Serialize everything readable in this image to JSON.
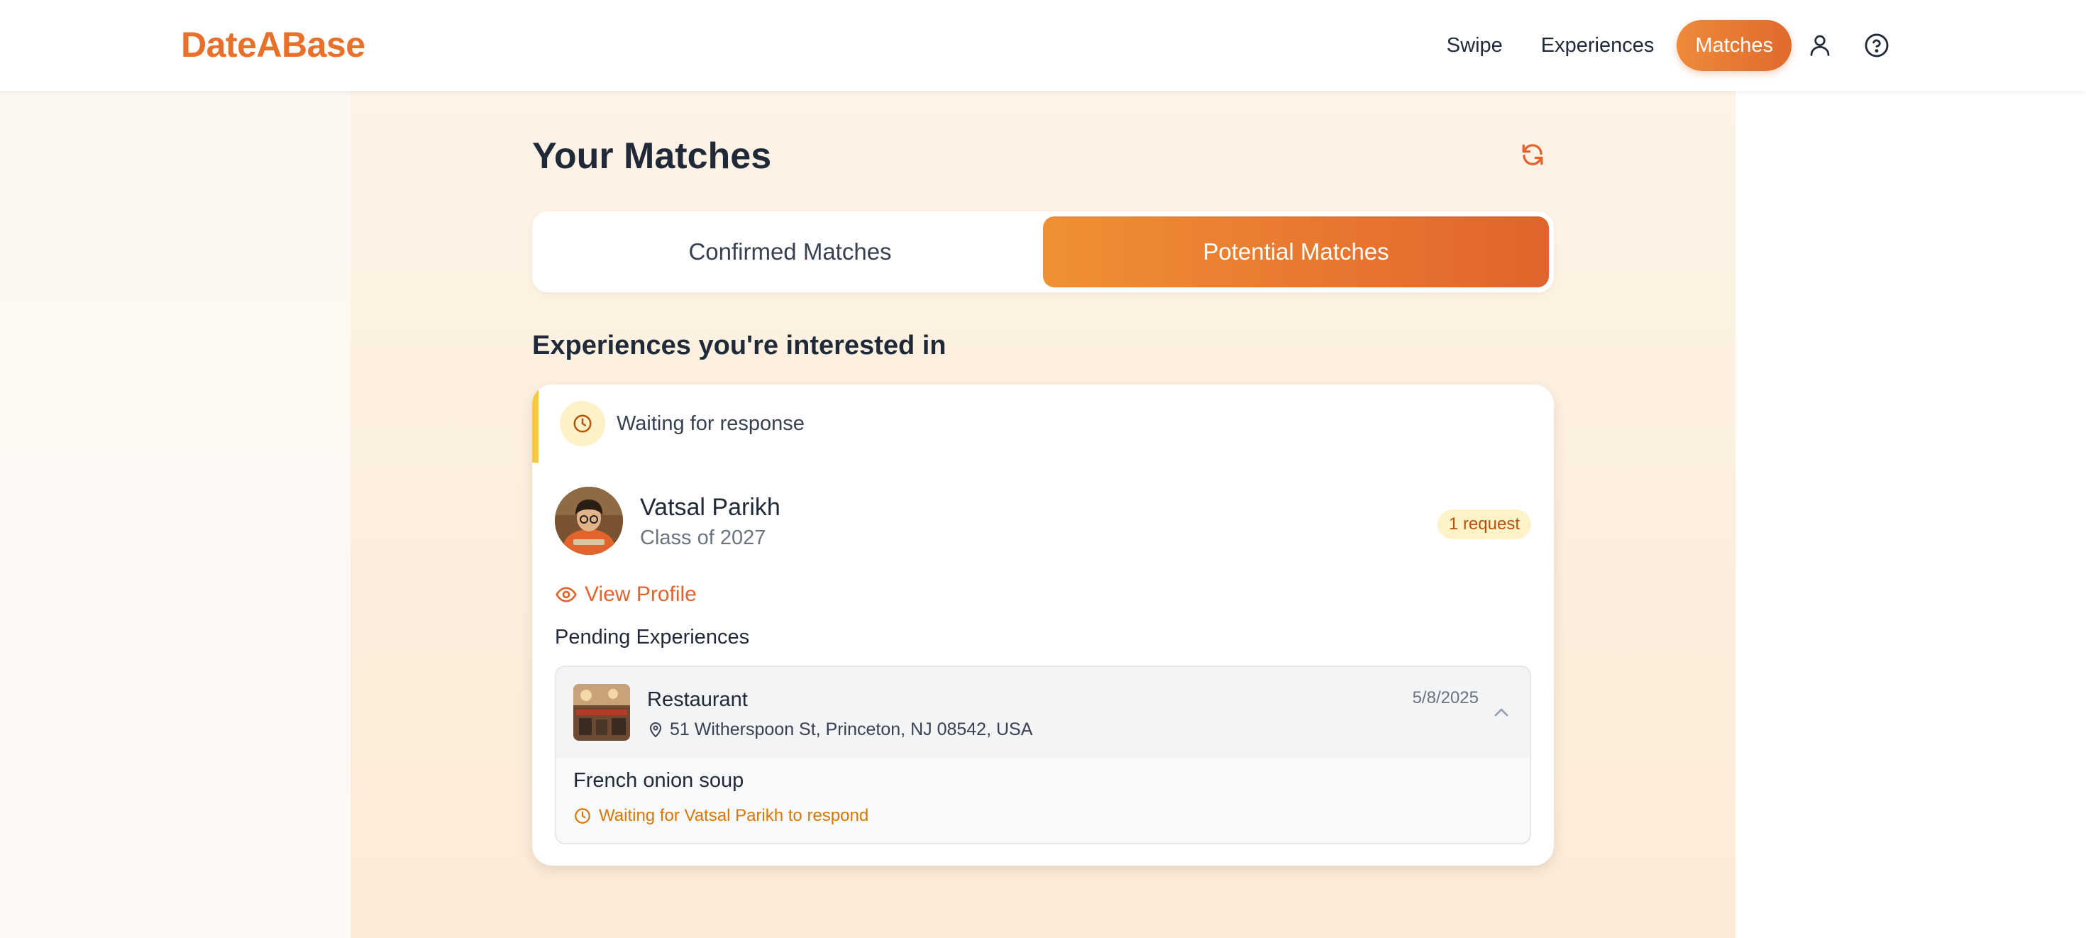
{
  "app": {
    "logo": "DateABase",
    "accent": "#e8702a"
  },
  "nav": {
    "swipe": "Swipe",
    "experiences": "Experiences",
    "matches": "Matches",
    "icons": [
      "profile-icon",
      "help-icon"
    ]
  },
  "page": {
    "title": "Your Matches",
    "refresh_icon": "refresh-icon"
  },
  "tabs": {
    "confirmed": "Confirmed Matches",
    "potential": "Potential Matches",
    "active": "Potential Matches"
  },
  "section": {
    "title": "Experiences you're interested in"
  },
  "card": {
    "status": "Waiting for response",
    "status_color": "#f5c842",
    "person": {
      "name": "Vatsal Parikh",
      "class": "Class of 2027",
      "badge": "1 request"
    },
    "view_profile": "View Profile",
    "pending_label": "Pending Experiences",
    "experience": {
      "title": "Restaurant",
      "address": "51 Witherspoon St, Princeton, NJ 08542, USA",
      "date": "5/8/2025",
      "detail": "French onion soup",
      "waiting": "Waiting for Vatsal Parikh to respond"
    }
  }
}
